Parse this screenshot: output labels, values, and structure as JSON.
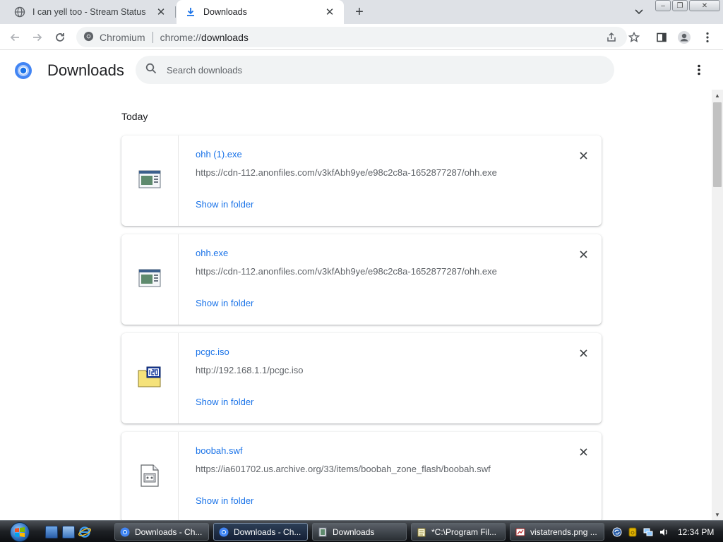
{
  "tabs": [
    {
      "title": "I can yell too - Stream Status",
      "active": false
    },
    {
      "title": "Downloads",
      "active": true
    }
  ],
  "window_buttons": {
    "minimize": "–",
    "restore": "❐",
    "close": "✕"
  },
  "toolbar": {
    "site_label": "Chromium",
    "url_scheme": "chrome://",
    "url_host": "downloads"
  },
  "downloads_page": {
    "title": "Downloads",
    "search_placeholder": "Search downloads",
    "section_label": "Today",
    "items": [
      {
        "filename": "ohh (1).exe",
        "url": "https://cdn-112.anonfiles.com/v3kfAbh9ye/e98c2c8a-1652877287/ohh.exe",
        "action": "Show in folder",
        "icon": "exe-file-icon"
      },
      {
        "filename": "ohh.exe",
        "url": "https://cdn-112.anonfiles.com/v3kfAbh9ye/e98c2c8a-1652877287/ohh.exe",
        "action": "Show in folder",
        "icon": "exe-file-icon"
      },
      {
        "filename": "pcgc.iso",
        "url": "http://192.168.1.1/pcgc.iso",
        "action": "Show in folder",
        "icon": "iso-file-icon"
      },
      {
        "filename": "boobah.swf",
        "url": "https://ia601702.us.archive.org/33/items/boobah_zone_flash/boobah.swf",
        "action": "Show in folder",
        "icon": "swf-file-icon"
      }
    ]
  },
  "taskbar": {
    "tasks": [
      {
        "label": "Downloads - Ch...",
        "active": false,
        "icon": "chromium-icon"
      },
      {
        "label": "Downloads - Ch...",
        "active": true,
        "icon": "chromium-icon"
      },
      {
        "label": "Downloads",
        "active": false,
        "icon": "folder-icon"
      },
      {
        "label": "*C:\\Program Fil...",
        "active": false,
        "icon": "notepad-icon"
      },
      {
        "label": "vistatrends.png ...",
        "active": false,
        "icon": "paint-icon"
      }
    ],
    "clock": "12:34 PM"
  },
  "colors": {
    "accent": "#1a73e8",
    "tabstrip": "#dee1e6",
    "omnibox": "#f1f3f4"
  }
}
